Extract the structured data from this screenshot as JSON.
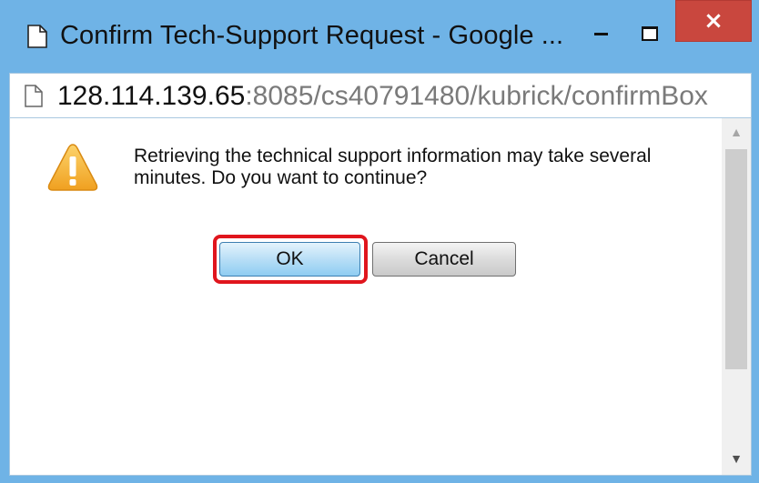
{
  "window": {
    "title": "Confirm Tech-Support Request - Google ...",
    "close_glyph": "×",
    "accent_color": "#6fb3e6",
    "close_color": "#c9473e"
  },
  "address": {
    "host": "128.114.139.65",
    "path": ":8085/cs40791480/kubrick/confirmBox"
  },
  "dialog": {
    "message": "Retrieving the technical support information may take several minutes. Do you want to continue?",
    "icon": "warning-icon",
    "ok_label": "OK",
    "cancel_label": "Cancel",
    "highlight_color": "#e0151d"
  },
  "scrollbar": {
    "up_glyph": "▲",
    "down_glyph": "▼"
  }
}
